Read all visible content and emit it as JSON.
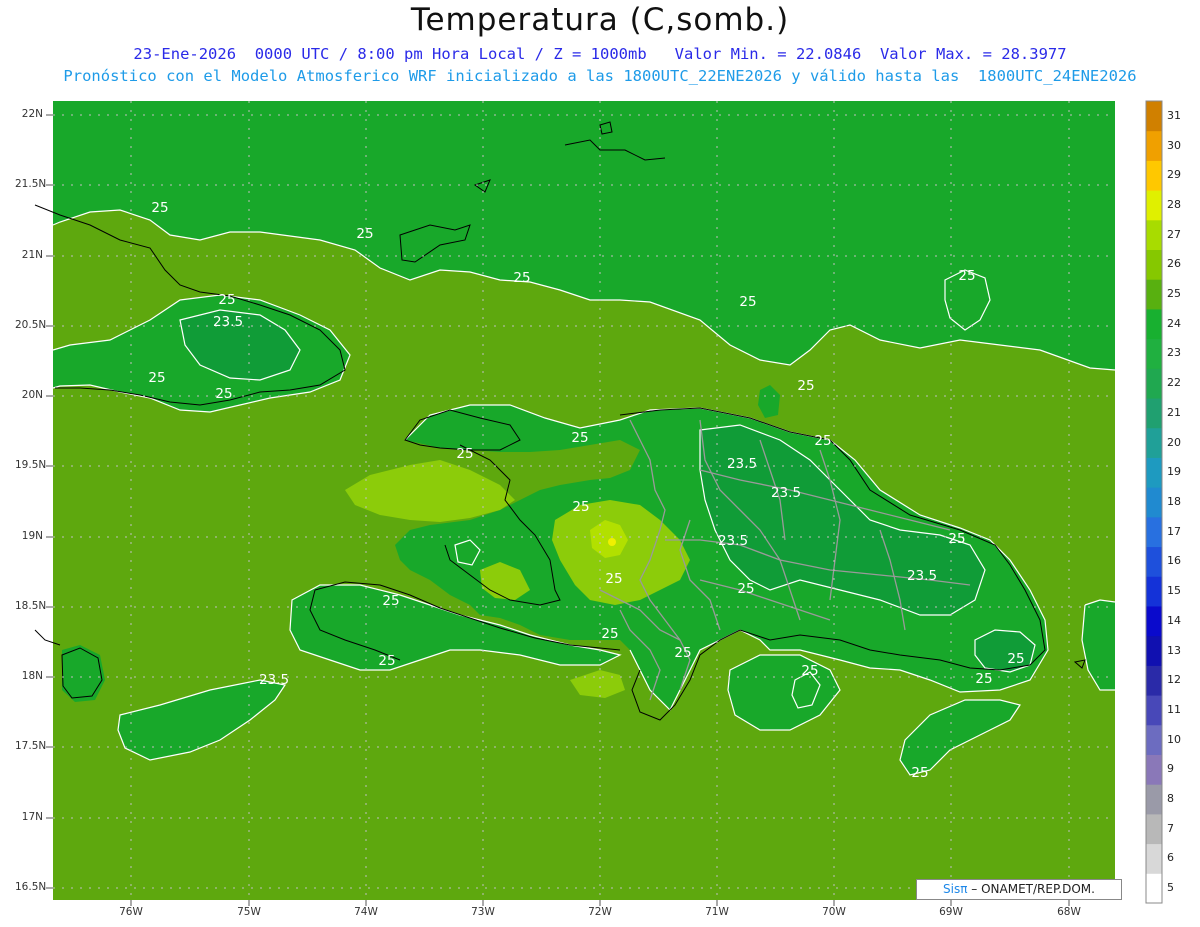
{
  "title": "Temperatura (C,somb.)",
  "subtitle_line1": "23-Ene-2026  0000 UTC / 8:00 pm Hora Local / Z = 1000mb   Valor Min. = 22.0846  Valor Max. = 28.3977",
  "subtitle_line2": "Pronóstico con el Modelo Atmosferico WRF inicializado a las 1800UTC_22ENE2026 y válido hasta las  1800UTC_24ENE2026",
  "variable": "Temperatura",
  "units": "C",
  "date": "23-Ene-2026",
  "time_utc": "0000 UTC",
  "time_local": "8:00 pm Hora Local",
  "level": "Z = 1000mb",
  "value_min": 22.0846,
  "value_max": 28.3977,
  "lat_labels": [
    "22N",
    "21.5N",
    "21N",
    "20.5N",
    "20N",
    "19.5N",
    "19N",
    "18.5N",
    "18N",
    "17.5N",
    "17N",
    "16.5N"
  ],
  "lon_labels": [
    "76W",
    "75W",
    "74W",
    "73W",
    "72W",
    "71W",
    "70W",
    "69W",
    "68W"
  ],
  "colorbar": {
    "labels": [
      "5",
      "6",
      "7",
      "8",
      "9",
      "10",
      "11",
      "12",
      "13",
      "14",
      "15",
      "16",
      "17",
      "18",
      "19",
      "20",
      "21",
      "22",
      "23",
      "24",
      "25",
      "26",
      "27",
      "28",
      "29",
      "30",
      "31"
    ],
    "colors": [
      "#ffffff",
      "#d8d8d8",
      "#b8b8b8",
      "#9a9aa8",
      "#8a78b8",
      "#6c6cc0",
      "#4848b8",
      "#2a2aa8",
      "#1010b0",
      "#0a0acc",
      "#1432d8",
      "#1e50dc",
      "#2870e0",
      "#208ad0",
      "#1e9ac0",
      "#20a098",
      "#20a070",
      "#20a850",
      "#20b040",
      "#18b030",
      "#58b010",
      "#86c800",
      "#a8dc00",
      "#e0f000",
      "#ffc800",
      "#f0a000",
      "#d08000"
    ]
  },
  "contour_labels": [
    "25",
    "25",
    "25",
    "23.5",
    "25",
    "25",
    "25",
    "25",
    "25",
    "25",
    "25",
    "25",
    "25",
    "23.5",
    "23.5",
    "23.5",
    "25",
    "25",
    "25",
    "23.5",
    "25",
    "25",
    "25",
    "25",
    "25",
    "25",
    "23.5",
    "25",
    "25",
    "25"
  ],
  "credit": {
    "sis": "Sis",
    "pi": "π",
    "rest": " – ONAMET/REP.DOM."
  }
}
